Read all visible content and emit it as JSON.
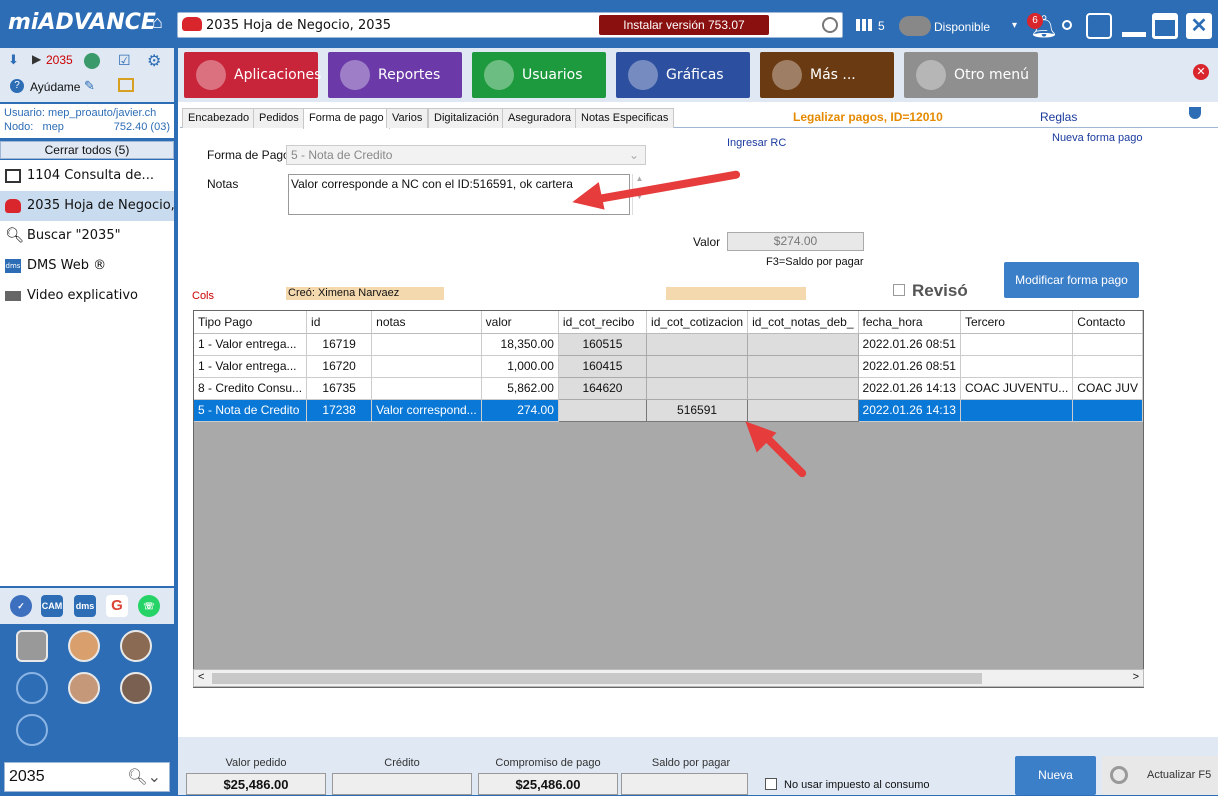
{
  "topbar": {
    "logo": "miADVANCE",
    "window_title": "2035 Hoja de Negocio, 2035",
    "install_label": "Instalar versión 753.07",
    "grid_count": "5",
    "status": "Disponible",
    "notifications": "6"
  },
  "sidebar": {
    "top_badge": "2035",
    "help_label": "Ayúdame",
    "user_label": "Usuario:",
    "user_value": "mep_proauto/javier.ch",
    "node_label": "Nodo:",
    "node_value": "mep",
    "node_amount": "752.40 (03)",
    "close_all": "Cerrar todos (5)",
    "items": [
      {
        "label": "1104 Consulta de...",
        "icon": "dashboard-icon"
      },
      {
        "label": "2035 Hoja de Negocio,...",
        "icon": "car-icon"
      },
      {
        "label": "Buscar \"2035\"",
        "icon": "search-icon"
      },
      {
        "label": "DMS Web ®",
        "icon": "dms-icon"
      },
      {
        "label": "Video explicativo",
        "icon": "video-icon"
      }
    ],
    "app_icons": [
      "advance-icon",
      "campus-icon",
      "dms-icon",
      "google-icon",
      "whatsapp-icon"
    ],
    "search_value": "2035"
  },
  "menu": {
    "buttons": [
      {
        "label": "Aplicaciones",
        "color": "#c8243a"
      },
      {
        "label": "Reportes",
        "color": "#6b3aa8"
      },
      {
        "label": "Usuarios",
        "color": "#1e9a3e"
      },
      {
        "label": "Gráficas",
        "color": "#2d4fa0"
      },
      {
        "label": "Más ...",
        "color": "#6a3a12"
      },
      {
        "label": "Otro menú",
        "color": "#8f8f8f"
      }
    ]
  },
  "tabs": [
    "Encabezado",
    "Pedidos",
    "Forma de pago",
    "Varios",
    "Digitalización",
    "Aseguradora",
    "Notas Especificas"
  ],
  "active_tab": "Forma de pago",
  "legalizar": "Legalizar pagos, ID=12010",
  "reglas": "Reglas",
  "form": {
    "forma_pago_label": "Forma de Pago",
    "forma_pago_value": "5 - Nota de Credito",
    "notas_label": "Notas",
    "notas_value": "Valor corresponde a NC con el ID:516591, ok cartera",
    "ingresar_rc": "Ingresar RC",
    "nueva_forma_pago": "Nueva forma pago",
    "valor_label": "Valor",
    "valor_value": "$274.00",
    "f3_hint": "F3=Saldo por pagar",
    "modificar_btn": "Modificar forma pago",
    "creo": "Creó: Ximena Narvaez",
    "reviso": "Revisó",
    "cols": "Cols"
  },
  "grid": {
    "columns": [
      "Tipo Pago",
      "id",
      "notas",
      "valor",
      "id_cot_recibo",
      "id_cot_cotizacion",
      "id_cot_notas_deb_",
      "fecha_hora",
      "Tercero",
      "Contacto"
    ],
    "rows": [
      [
        "1 - Valor entrega...",
        "16719",
        "",
        "18,350.00",
        "160515",
        "",
        "",
        "2022.01.26 08:51",
        "",
        ""
      ],
      [
        "1 - Valor entrega...",
        "16720",
        "",
        "1,000.00",
        "160415",
        "",
        "",
        "2022.01.26 08:51",
        "",
        ""
      ],
      [
        "8 - Credito Consu...",
        "16735",
        "",
        "5,862.00",
        "164620",
        "",
        "",
        "2022.01.26 14:13",
        "COAC JUVENTU...",
        "COAC JUV"
      ],
      [
        "5 - Nota de Credito",
        "17238",
        "Valor correspond...",
        "274.00",
        "",
        "516591",
        "",
        "2022.01.26 14:13",
        "",
        ""
      ]
    ],
    "selected_row": 3
  },
  "footer": {
    "valor_pedido_label": "Valor pedido",
    "valor_pedido": "$25,486.00",
    "credito_label": "Crédito",
    "credito": "",
    "compromiso_label": "Compromiso de pago",
    "compromiso": "$25,486.00",
    "saldo_label": "Saldo por pagar",
    "saldo": "",
    "no_impuesto": "No usar impuesto al consumo",
    "nueva": "Nueva",
    "actualizar": "Actualizar F5"
  }
}
